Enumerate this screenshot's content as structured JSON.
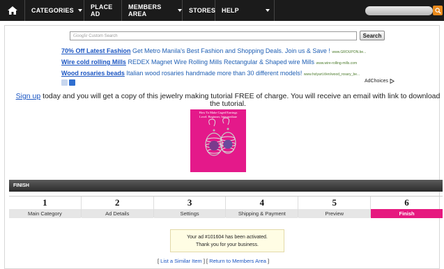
{
  "nav": {
    "items": [
      {
        "label": "CATEGORIES",
        "has_dropdown": true
      },
      {
        "label": "PLACE AD",
        "has_dropdown": false
      },
      {
        "label": "MEMBERS AREA",
        "has_dropdown": true
      },
      {
        "label": "STORES",
        "has_dropdown": false
      },
      {
        "label": "HELP",
        "has_dropdown": true
      }
    ],
    "search_icon": "magnifier-icon",
    "home_icon": "home-icon"
  },
  "google_search": {
    "logo": "Google",
    "placeholder": "Custom Search",
    "button": "Search"
  },
  "ads": [
    {
      "title": "70% Off Latest Fashion",
      "desc": "Get Metro Manila's Best Fashion and Shopping Deals. Join us & Save !",
      "url": "www.GROUPON.be..."
    },
    {
      "title": "Wire cold rolling Mills",
      "desc": "REDEX Magnet Wire Rolling Mills Rectangular & Shaped wire Mills",
      "url": "www.wire-rolling-mills.com"
    },
    {
      "title": "Wood rosaries beads",
      "desc": "Italian wood rosaries handmade more than 30 different models!",
      "url": "www.holyart.it/en/wood_rosary_be..."
    }
  ],
  "ad_choices": "AdChoices",
  "promo": {
    "link": "Sign up",
    "text": "today and you will get a copy of this jewelry making tutorial FREE of charge. You will receive an email with link to download the tutorial."
  },
  "book": {
    "title_line1": "How To Make Caged Earrings",
    "title_line2": "Level: Beginner, Intermediate"
  },
  "finish_title": "FINISH",
  "steps": [
    {
      "num": "1",
      "label": "Main Category"
    },
    {
      "num": "2",
      "label": "Ad Details"
    },
    {
      "num": "3",
      "label": "Settings"
    },
    {
      "num": "4",
      "label": "Shipping & Payment"
    },
    {
      "num": "5",
      "label": "Preview"
    },
    {
      "num": "6",
      "label": "Finish"
    }
  ],
  "active_step": 6,
  "notice": {
    "line1": "Your ad #101604 has been activated.",
    "line2": "Thank you for your business."
  },
  "links": {
    "similar": "List a Similar Item",
    "members": "Return to Members Area"
  },
  "colors": {
    "accent": "#e6197f",
    "nav_bg": "#1b1b1b",
    "link": "#1a55c2",
    "search_btn": "#e98a1d"
  }
}
